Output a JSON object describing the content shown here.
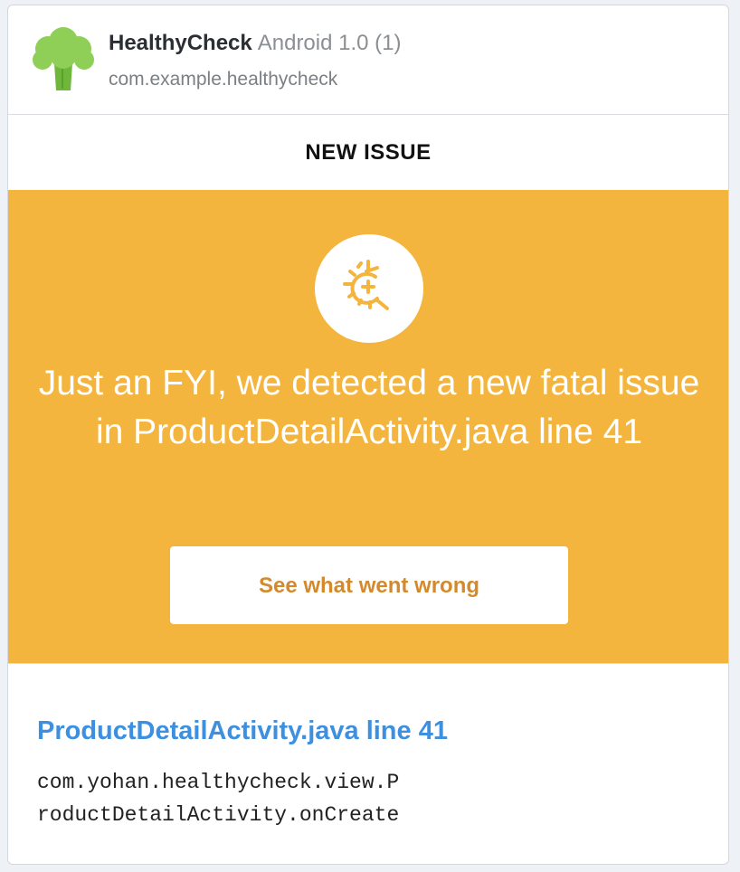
{
  "app": {
    "name": "HealthyCheck",
    "version": "Android 1.0 (1)",
    "package": "com.example.healthycheck",
    "logo_icon": "broccoli-icon"
  },
  "section": {
    "label": "NEW ISSUE"
  },
  "alert": {
    "icon": "bug-crash-icon",
    "message": "Just an FYI, we detected a new fatal issue in ProductDetailActivity.java line 41",
    "button_label": "See what went wrong",
    "background_color": "#f3b53e",
    "button_text_color": "#d48a2c"
  },
  "issue": {
    "title": "ProductDetailActivity.java line 41",
    "stack_lines": [
      "com.yohan.healthycheck.view.P",
      "roductDetailActivity.onCreate"
    ],
    "title_color": "#3d8fe0"
  }
}
